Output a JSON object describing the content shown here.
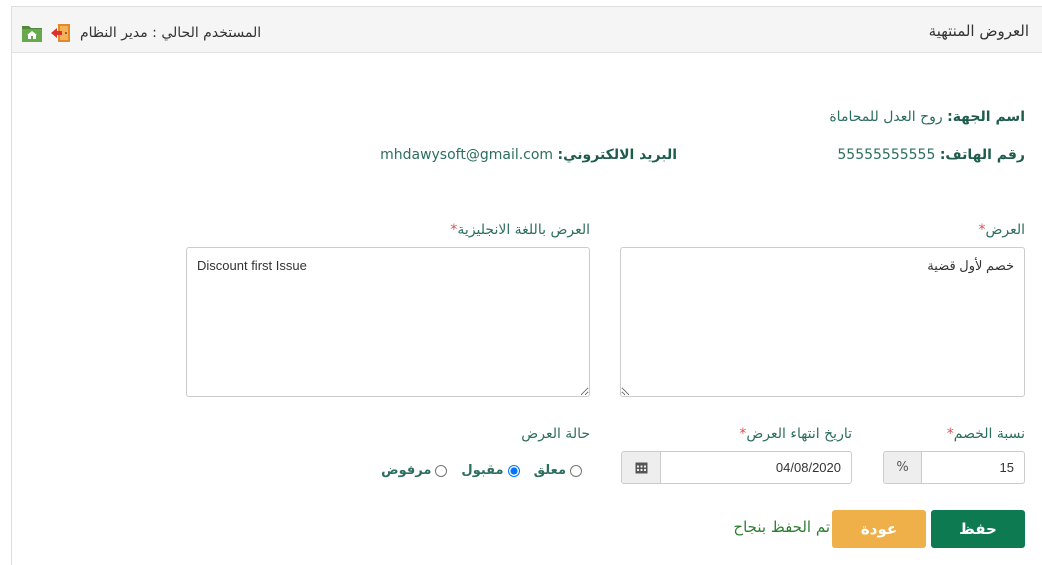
{
  "header": {
    "title": "العروض المنتهية",
    "current_user": "المستخدم الحالي : مدير النظام"
  },
  "entity": {
    "name_label": "اسم الجهة:",
    "name_value": "روح العدل للمحاماة",
    "phone_label": "رقم الهاتف:",
    "phone_value": "55555555555",
    "email_label": "البريد الالكتروني:",
    "email_value": "mhdawysoft@gmail.com"
  },
  "form": {
    "offer_label": "العرض",
    "offer_value": "خصم لأول قضية",
    "offer_en_label": "العرض باللغة الانجليزية",
    "offer_en_value": "Discount first Issue",
    "required_mark": "*",
    "discount_label": "نسبة الخصم",
    "discount_value": "15",
    "discount_unit": "%",
    "expiry_label": "تاريخ انتهاء العرض",
    "expiry_value": "04/08/2020",
    "status_label": "حالة العرض",
    "status_options": [
      "معلق",
      "مقبول",
      "مرفوض"
    ],
    "status_selected": "مقبول"
  },
  "actions": {
    "save_label": "حفظ",
    "back_label": "عودة",
    "success_message": "تم الحفظ بنجاح"
  },
  "colors": {
    "primary_green": "#0e7a52",
    "back_orange": "#efb04a",
    "label_teal": "#2c6e5f",
    "required_red": "#d9534f"
  }
}
